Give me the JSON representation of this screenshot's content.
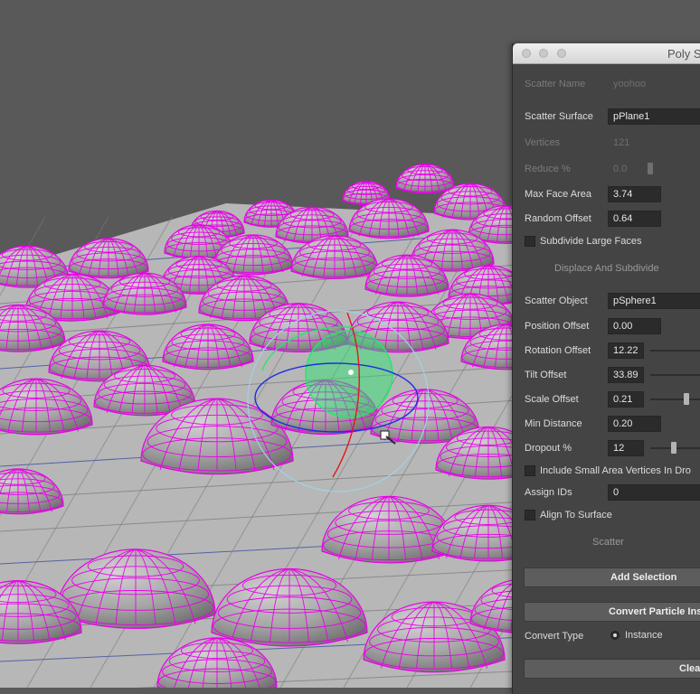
{
  "window": {
    "title": "Poly Scatter"
  },
  "form": {
    "scatter_name": {
      "label": "Scatter Name",
      "value": "yoohoo"
    },
    "scatter_surface": {
      "label": "Scatter Surface",
      "value": "pPlane1"
    },
    "vertices": {
      "label": "Vertices",
      "value": "121"
    },
    "reduce": {
      "label": "Reduce %",
      "value": "0.0"
    },
    "max_face_area": {
      "label": "Max Face Area",
      "value": "3.74"
    },
    "random_offset": {
      "label": "Random Offset",
      "value": "0.64"
    },
    "subdivide_large_faces": {
      "label": "Subdivide Large Faces",
      "checked": false
    },
    "displace_section": "Displace And Subdivide",
    "scatter_object": {
      "label": "Scatter Object",
      "value": "pSphere1"
    },
    "position_offset": {
      "label": "Position Offset",
      "value": "0.00"
    },
    "rotation_offset": {
      "label": "Rotation Offset",
      "value": "12.22"
    },
    "tilt_offset": {
      "label": "Tilt Offset",
      "value": "33.89"
    },
    "scale_offset": {
      "label": "Scale Offset",
      "value": "0.21"
    },
    "min_distance": {
      "label": "Min Distance",
      "value": "0.20"
    },
    "dropout": {
      "label": "Dropout %",
      "value": "12"
    },
    "include_small_area": {
      "label": "Include Small Area Vertices In Dro",
      "checked": false
    },
    "assign_ids": {
      "label": "Assign IDs",
      "value": "0"
    },
    "align_to_surface": {
      "label": "Align To Surface",
      "checked": false
    },
    "scatter_section": "Scatter",
    "add_selection_button": "Add Selection",
    "convert_particle_button": "Convert Particle Ins",
    "convert_type": {
      "label": "Convert Type",
      "option": "Instance"
    },
    "clear_button": "Clea"
  },
  "colors": {
    "wire": "#e800e8",
    "sphere_fill": "#9a9a9a",
    "ground": "#b9b9b9",
    "manip_green": "#22e86b",
    "manip_red": "#e01818",
    "manip_blue": "#1a2ee0",
    "manip_cyan": "#9fd3e6"
  }
}
